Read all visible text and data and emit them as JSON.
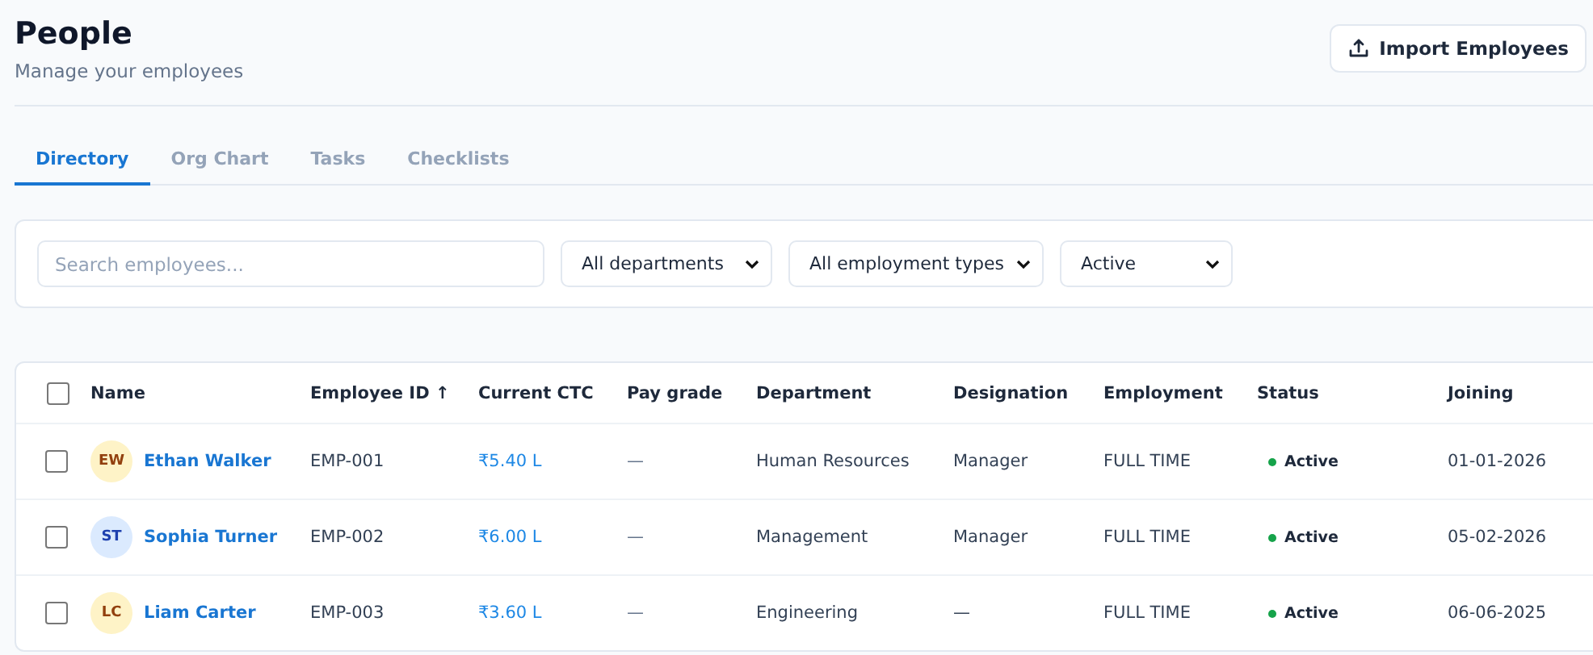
{
  "header": {
    "title": "People",
    "subtitle": "Manage your employees",
    "import_button": "Import Employees"
  },
  "tabs": [
    {
      "label": "Directory",
      "selected": true
    },
    {
      "label": "Org Chart",
      "selected": false
    },
    {
      "label": "Tasks",
      "selected": false
    },
    {
      "label": "Checklists",
      "selected": false
    }
  ],
  "filters": {
    "search": {
      "placeholder": "Search employees..."
    },
    "selects": [
      "All departments",
      "All employment types",
      "Active"
    ]
  },
  "table": {
    "select_all": {
      "checked": false
    },
    "columns": [
      "Name",
      "Employee ID ↑",
      "Current CTC",
      "Pay grade",
      "Department",
      "Designation",
      "Employment",
      "Status",
      "Joining"
    ],
    "rows": [
      {
        "checked": false,
        "initials": "EW",
        "color": "#fef3c7",
        "name": "Ethan Walker",
        "employee_id": "EMP-001",
        "ctc": "₹5.40 L",
        "pay_grade": "—",
        "department": "Human Resources",
        "designation": "Manager",
        "employment": "FULL TIME",
        "status": "Active",
        "joining": "01-01-2026"
      },
      {
        "checked": false,
        "initials": "ST",
        "color": "#dbeafe",
        "name": "Sophia Turner",
        "employee_id": "EMP-002",
        "ctc": "₹6.00 L",
        "pay_grade": "—",
        "department": "Management",
        "designation": "Manager",
        "employment": "FULL TIME",
        "status": "Active",
        "joining": "05-02-2026"
      },
      {
        "checked": false,
        "initials": "LC",
        "color": "#fef3c7",
        "name": "Liam Carter",
        "employee_id": "EMP-003",
        "ctc": "₹3.60 L",
        "pay_grade": "—",
        "department": "Engineering",
        "designation": "—",
        "employment": "FULL TIME",
        "status": "Active",
        "joining": "06-06-2025"
      }
    ]
  }
}
